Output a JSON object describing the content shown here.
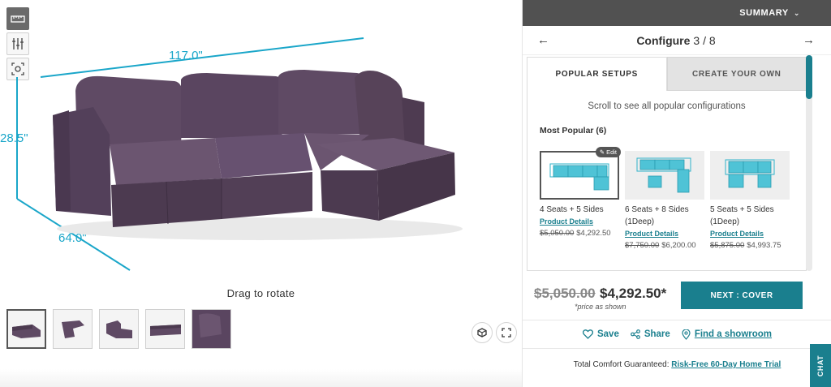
{
  "viewer": {
    "dimensions": {
      "width": "117.0\"",
      "height": "28.5\"",
      "depth": "64.0\""
    },
    "drag_hint": "Drag to rotate",
    "sofa_color": "#5b4660",
    "dimension_color": "#1aa6c9",
    "tools": [
      "dimensions-icon",
      "adjust-icon",
      "ar-view-icon"
    ],
    "thumbnails": [
      "view-front-left",
      "view-top",
      "view-side",
      "view-front",
      "view-back-closeup"
    ]
  },
  "summary": {
    "label": "SUMMARY"
  },
  "configure": {
    "title": "Configure",
    "step": "3 / 8"
  },
  "tabs": [
    {
      "label": "POPULAR SETUPS",
      "active": true
    },
    {
      "label": "CREATE YOUR OWN",
      "active": false
    }
  ],
  "popular": {
    "scroll_hint": "Scroll to see all popular configurations",
    "section_title": "Most Popular (6)",
    "cards": [
      {
        "name": "4 Seats + 5 Sides",
        "link": "Product Details",
        "old_price": "$5,050.00",
        "price": "$4,292.50",
        "badge": "Edit"
      },
      {
        "name": "6 Seats + 8 Sides (1Deep)",
        "link": "Product Details",
        "old_price": "$7,750.00",
        "price": "$6,200.00"
      },
      {
        "name": "5 Seats + 5 Sides (1Deep)",
        "link": "Product Details",
        "old_price": "$5,875.00",
        "price": "$4,993.75"
      }
    ]
  },
  "pricing": {
    "old_price": "$5,050.00",
    "price": "$4,292.50*",
    "note": "*price as shown",
    "next_button": "NEXT : COVER"
  },
  "actions": {
    "save": "Save",
    "share": "Share",
    "showroom": "Find a showroom"
  },
  "guarantee": {
    "text": "Total Comfort Guaranteed: ",
    "link": "Risk-Free 60-Day Home Trial"
  },
  "chat": {
    "label": "CHAT"
  },
  "colors": {
    "accent": "#1a7f8e",
    "header": "#515151",
    "diagram": "#4fc3d6"
  }
}
